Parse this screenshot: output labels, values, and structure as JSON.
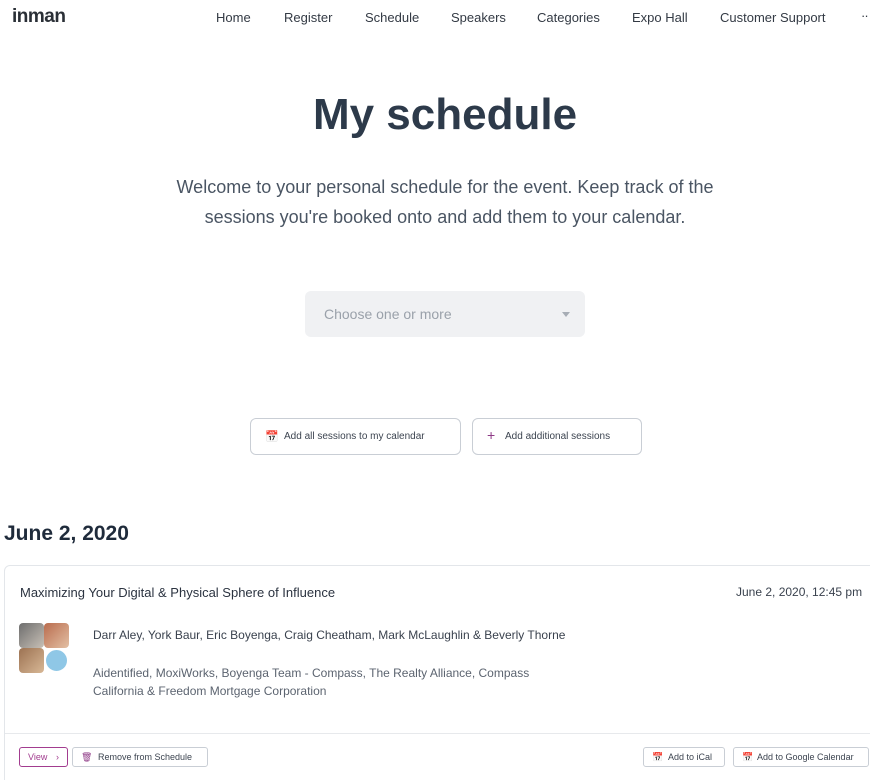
{
  "header": {
    "logo": "inman",
    "nav": [
      {
        "label": "Home"
      },
      {
        "label": "Register"
      },
      {
        "label": "Schedule"
      },
      {
        "label": "Speakers"
      },
      {
        "label": "Categories"
      },
      {
        "label": "Expo Hall"
      },
      {
        "label": "Customer Support"
      }
    ],
    "more": "··"
  },
  "page": {
    "title": "My schedule",
    "intro": "Welcome to your personal schedule for the event. Keep track of the sessions you're booked onto and add them to your calendar."
  },
  "filter": {
    "placeholder": "Choose one or more"
  },
  "actions": {
    "add_all_label": "Add all sessions to my calendar",
    "add_additional_label": "Add additional sessions"
  },
  "days": [
    {
      "date": "June 2, 2020",
      "sessions": [
        {
          "title": "Maximizing Your Digital & Physical Sphere of Influence",
          "time": "June 2, 2020, 12:45 pm",
          "speakers": "Darr Aley, York Baur, Eric Boyenga, Craig Cheatham, Mark McLaughlin & Beverly Thorne",
          "organizations": "Aidentified, MoxiWorks, Boyenga Team - Compass, The Realty Alliance, Compass California & Freedom Mortgage Corporation",
          "view_label": "View",
          "remove_label": "Remove from Schedule",
          "ical_label": "Add to iCal",
          "gcal_label": "Add to Google Calendar"
        }
      ]
    }
  ],
  "colors": {
    "accent": "#8e3a86",
    "heading": "#2d3a4a",
    "select_bg": "#f0f1f3"
  }
}
